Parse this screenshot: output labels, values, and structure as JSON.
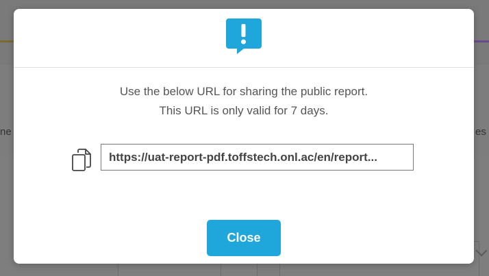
{
  "background": {
    "left_fragment": "ne",
    "right_fragment": "es"
  },
  "modal": {
    "icon": "alert-speech-bubble-icon",
    "message_line1": "Use the below URL for sharing the public report.",
    "message_line2": "This URL is only valid for 7 days.",
    "copy_icon": "copy-icon",
    "url_value": "https://uat-report-pdf.toffstech.onl.ac/en/report...",
    "close_label": "Close"
  },
  "colors": {
    "accent": "#1fa7dc",
    "overlay": "#7d7d7d"
  }
}
